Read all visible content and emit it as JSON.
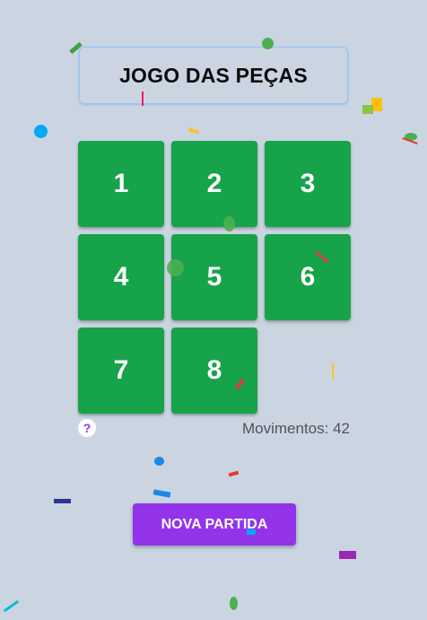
{
  "title": "JOGO DAS PEÇAS",
  "tiles": [
    "1",
    "2",
    "3",
    "4",
    "5",
    "6",
    "7",
    "8"
  ],
  "empty_slot": 9,
  "moves_label": "Movimentos: 42",
  "help_label": "?",
  "new_game_label": "NOVA PARTIDA",
  "colors": {
    "background": "#cbd5e1",
    "tile": "#16a34a",
    "button": "#9333ea",
    "title_border": "#93c5fd"
  }
}
